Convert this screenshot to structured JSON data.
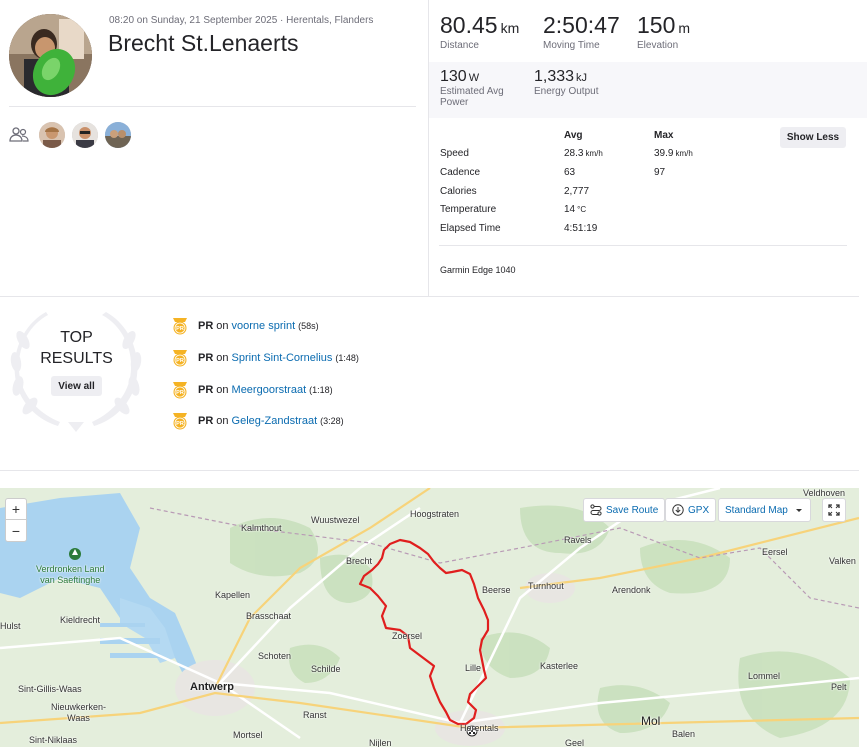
{
  "activity": {
    "meta": "08:20 on Sunday, 21 September 2025 · Herentals, Flanders",
    "athlete": "Brecht St.Lenaerts"
  },
  "stats_primary": [
    {
      "value": "80.45",
      "unit": "km",
      "label": "Distance"
    },
    {
      "value": "2:50:47",
      "unit": "",
      "label": "Moving Time"
    },
    {
      "value": "150",
      "unit": "m",
      "label": "Elevation"
    }
  ],
  "stats_secondary": [
    {
      "value": "130",
      "unit": "W",
      "label1": "Estimated Avg",
      "label2": "Power"
    },
    {
      "value": "1,333",
      "unit": "kJ",
      "label1": "Energy Output",
      "label2": ""
    }
  ],
  "table": {
    "avg_header": "Avg",
    "max_header": "Max",
    "show_less": "Show Less",
    "rows": [
      {
        "label": "Speed",
        "avg": "28.3",
        "avg_unit": "km/h",
        "max": "39.9",
        "max_unit": "km/h"
      },
      {
        "label": "Cadence",
        "avg": "63",
        "avg_unit": "",
        "max": "97",
        "max_unit": ""
      },
      {
        "label": "Calories",
        "avg": "2,777",
        "avg_unit": "",
        "max": "",
        "max_unit": ""
      },
      {
        "label": "Temperature",
        "avg": "14",
        "avg_unit": "°C",
        "max": "",
        "max_unit": ""
      },
      {
        "label": "Elapsed Time",
        "avg": "4:51:19",
        "avg_unit": "",
        "max": "",
        "max_unit": ""
      }
    ],
    "device": "Garmin Edge 1040"
  },
  "top_results": {
    "title_line1": "TOP",
    "title_line2": "RESULTS",
    "view_all": "View all",
    "badge_text": "PR",
    "items": [
      {
        "pr": "PR",
        "on": "on",
        "segment": "voorne sprint",
        "time": "(58s)"
      },
      {
        "pr": "PR",
        "on": "on",
        "segment": "Sprint Sint-Cornelius",
        "time": "(1:48)"
      },
      {
        "pr": "PR",
        "on": "on",
        "segment": "Meergoorstraat",
        "time": "(1:18)"
      },
      {
        "pr": "PR",
        "on": "on",
        "segment": "Geleg-Zandstraat",
        "time": "(3:28)"
      }
    ]
  },
  "map": {
    "zoom_in": "+",
    "zoom_out": "−",
    "save_route": "Save Route",
    "gpx": "GPX",
    "map_style": "Standard Map",
    "places": {
      "veldhoven": "Veldhoven",
      "hoogstraten": "Hoogstraten",
      "kalmthout": "Kalmthout",
      "wuustwezel": "Wuustwezel",
      "ravels": "Ravels",
      "eersel": "Eersel",
      "brecht": "Brecht",
      "valken": "Valken",
      "verdronken_1": "Verdronken Land",
      "verdronken_2": "van Saeftinghe",
      "kapellen": "Kapellen",
      "beerse": "Beerse",
      "turnhout": "Turnhout",
      "arendonk": "Arendonk",
      "brasschaat": "Brasschaat",
      "hulst": "Hulst",
      "kieldrecht": "Kieldrecht",
      "zoersel": "Zoersel",
      "schoten": "Schoten",
      "schilde": "Schilde",
      "lille": "Lille",
      "kasterlee": "Kasterlee",
      "lommel": "Lommel",
      "sint_gillis": "Sint-Gillis-Waas",
      "antwerp": "Antwerp",
      "pelt": "Pelt",
      "nieuwkerken_1": "Nieuwkerken-",
      "nieuwkerken_2": "Waas",
      "ranst": "Ranst",
      "herentals": "Herentals",
      "mol": "Mol",
      "sint_niklaas": "Sint-Niklaas",
      "mortsel": "Mortsel",
      "nijlen": "Nijlen",
      "geel": "Geel",
      "balen": "Balen"
    }
  },
  "colors": {
    "route": "#e01e1e",
    "link": "#0a6bb0",
    "pr_badge": "#f5b324",
    "map_land": "#dfecd7",
    "map_water": "#aad3f0"
  }
}
